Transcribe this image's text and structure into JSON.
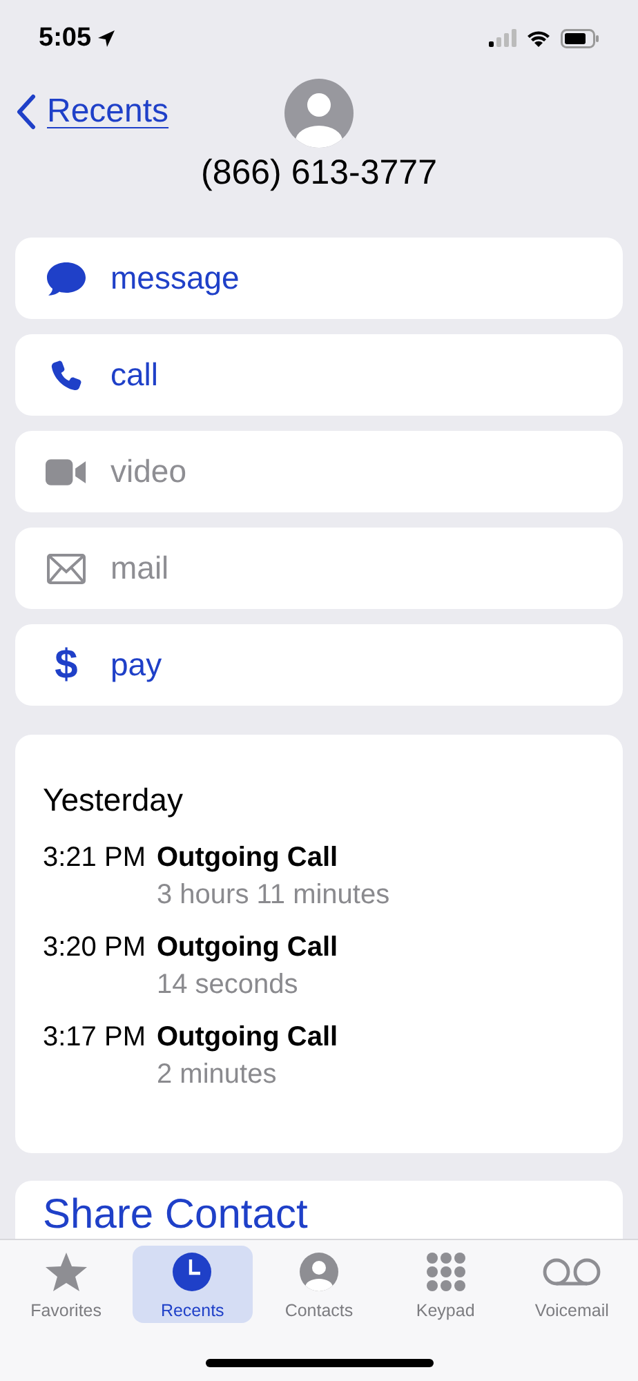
{
  "status_bar": {
    "time": "5:05"
  },
  "nav": {
    "back_label": "Recents"
  },
  "contact": {
    "phone": "(866) 613-3777"
  },
  "actions": [
    {
      "kind": "message",
      "label": "message",
      "disabled": false
    },
    {
      "kind": "call",
      "label": "call",
      "disabled": false
    },
    {
      "kind": "video",
      "label": "video",
      "disabled": true
    },
    {
      "kind": "mail",
      "label": "mail",
      "disabled": true
    },
    {
      "kind": "pay",
      "label": "pay",
      "icon": "$",
      "disabled": false
    }
  ],
  "history": {
    "heading": "Yesterday",
    "calls": [
      {
        "time": "3:21 PM",
        "type": "Outgoing Call",
        "duration": "3 hours 11 minutes"
      },
      {
        "time": "3:20 PM",
        "type": "Outgoing Call",
        "duration": "14 seconds"
      },
      {
        "time": "3:17 PM",
        "type": "Outgoing Call",
        "duration": "2 minutes"
      }
    ]
  },
  "share": {
    "label": "Share Contact"
  },
  "tabs": [
    {
      "kind": "favorites",
      "label": "Favorites",
      "selected": false
    },
    {
      "kind": "recents",
      "label": "Recents",
      "selected": true
    },
    {
      "kind": "contacts",
      "label": "Contacts",
      "selected": false
    },
    {
      "kind": "keypad",
      "label": "Keypad",
      "selected": false
    },
    {
      "kind": "voicemail",
      "label": "Voicemail",
      "selected": false
    }
  ]
}
